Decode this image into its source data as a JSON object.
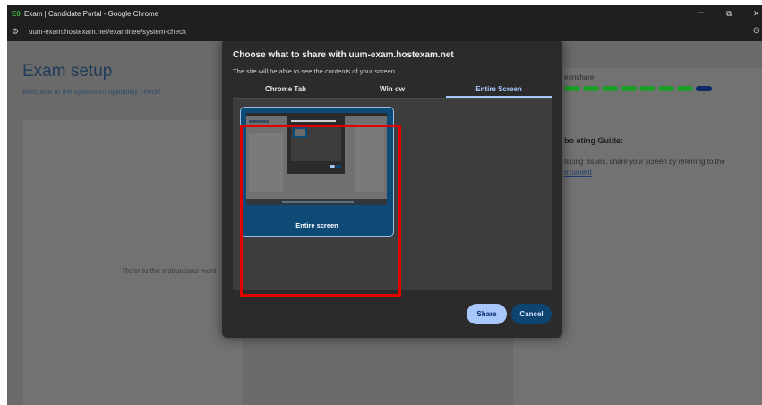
{
  "window": {
    "favicon": "E0",
    "title": "Exam | Candidate Portal - Google Chrome",
    "url": "uum-exam.hostexam.net/examinee/system-check",
    "controls": {
      "minimize": "–",
      "restore": "⧉",
      "close": "✕"
    }
  },
  "page": {
    "title": "Exam setup",
    "subtitle": "Welcome to the system compatibility check!",
    "refer_text": "Refer to the instructions ment",
    "right": {
      "step_label": "eenshare",
      "progress": {
        "segments": 8,
        "completed": 7,
        "current": 8
      },
      "guide_title": "bo eting Guide:",
      "guide_text": "facing issues, share your screen by referring to the",
      "guide_link": "ocument"
    }
  },
  "dialog": {
    "title": "Choose what to share with uum-exam.hostexam.net",
    "subtitle": "The site will be able to see the contents of your screen",
    "tabs": [
      {
        "label": "Chrome Tab",
        "active": false
      },
      {
        "label": "Win  ow",
        "active": false
      },
      {
        "label": "Entire Screen",
        "active": true
      }
    ],
    "screen_option": {
      "label": "Entire screen"
    },
    "share_label": "Share",
    "cancel_label": "Cancel"
  },
  "colors": {
    "accent": "#a8c7fa",
    "progress_done": "#1f9d2a",
    "progress_current": "#0b2a66",
    "highlight": "#e00000"
  }
}
